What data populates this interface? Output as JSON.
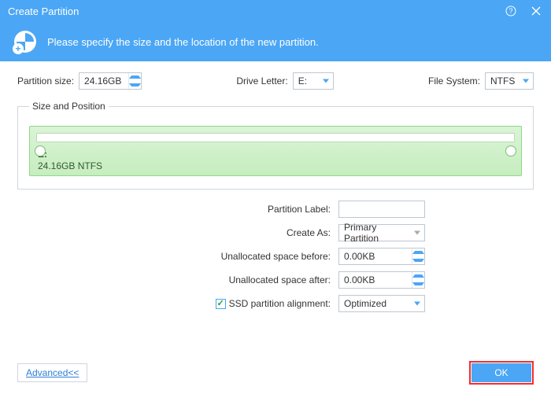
{
  "title": "Create Partition",
  "header_text": "Please specify the size and the location of the new partition.",
  "top": {
    "partition_size_label": "Partition size:",
    "partition_size_value": "24.16GB",
    "drive_letter_label": "Drive Letter:",
    "drive_letter_value": "E:",
    "file_system_label": "File System:",
    "file_system_value": "NTFS"
  },
  "size_pos_legend": "Size and Position",
  "partition_preview": {
    "letter": "E:",
    "info": "24.16GB NTFS"
  },
  "form": {
    "partition_label_label": "Partition Label:",
    "partition_label_value": "",
    "create_as_label": "Create As:",
    "create_as_value": "Primary Partition",
    "unalloc_before_label": "Unallocated space before:",
    "unalloc_before_value": "0.00KB",
    "unalloc_after_label": "Unallocated space after:",
    "unalloc_after_value": "0.00KB",
    "ssd_align_label": "SSD partition alignment:",
    "ssd_align_checked": true,
    "ssd_align_value": "Optimized"
  },
  "footer": {
    "advanced": "Advanced<<",
    "ok": "OK"
  }
}
